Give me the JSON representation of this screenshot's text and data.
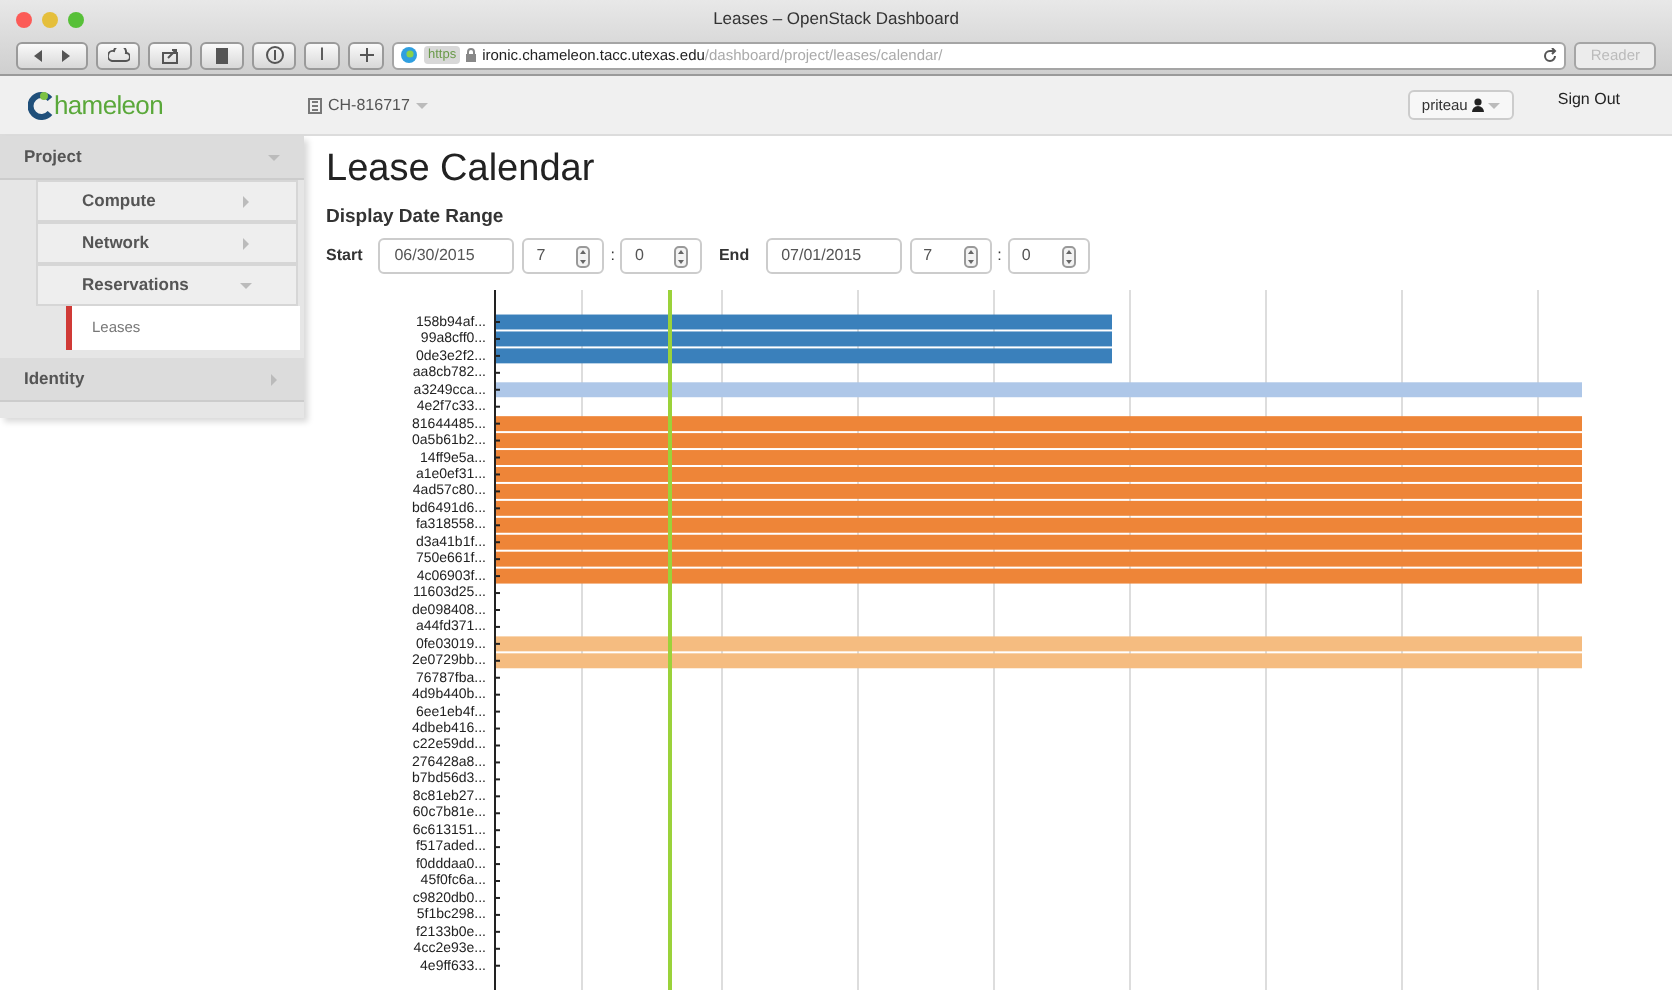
{
  "browser": {
    "title": "Leases – OpenStack Dashboard",
    "scheme": "https",
    "host": "ironic.chameleon.tacc.utexas.edu",
    "path": "/dashboard/project/leases/calendar/",
    "toolbar_glyph": "I",
    "reader": {
      "label": "Reader",
      "disabled": true
    }
  },
  "topbar": {
    "logo": "hameleon",
    "project": "CH-816717",
    "user": "priteau",
    "sign_out": "Sign Out"
  },
  "sidebar": [
    {
      "label": "Project",
      "expanded": true,
      "children": [
        {
          "label": "Compute",
          "expanded": false
        },
        {
          "label": "Network",
          "expanded": false
        },
        {
          "label": "Reservations",
          "expanded": true,
          "children": [
            {
              "label": "Leases",
              "selected": true
            }
          ]
        }
      ]
    },
    {
      "label": "Identity",
      "expanded": false
    }
  ],
  "page": {
    "title": "Lease Calendar",
    "subtitle": "Display Date Range",
    "start": {
      "label": "Start",
      "date": "06/30/2015",
      "hour": "7",
      "minute": "0"
    },
    "separator": ":",
    "end": {
      "label": "End",
      "date": "07/01/2015",
      "hour": "7",
      "minute": "0"
    }
  },
  "leases": [
    {
      "label": "158b94af...",
      "kind": "short",
      "color": "#3a80bb"
    },
    {
      "label": "99a8cff0...",
      "kind": "short",
      "color": "#3a80bb"
    },
    {
      "label": "0de3e2f2...",
      "kind": "short",
      "color": "#3a80bb"
    },
    {
      "label": "aa8cb782...",
      "kind": "none"
    },
    {
      "label": "a3249cca...",
      "kind": "full",
      "color": "#aec7e8"
    },
    {
      "label": "4e2f7c33...",
      "kind": "none"
    },
    {
      "label": "81644485...",
      "kind": "full",
      "color": "#ee8538"
    },
    {
      "label": "0a5b61b2...",
      "kind": "full",
      "color": "#ee8538"
    },
    {
      "label": "14ff9e5a...",
      "kind": "full",
      "color": "#ee8538"
    },
    {
      "label": "a1e0ef31...",
      "kind": "full",
      "color": "#ee8538"
    },
    {
      "label": "4ad57c80...",
      "kind": "full",
      "color": "#ee8538"
    },
    {
      "label": "bd6491d6...",
      "kind": "full",
      "color": "#ee8538"
    },
    {
      "label": "fa318558...",
      "kind": "full",
      "color": "#ee8538"
    },
    {
      "label": "d3a41b1f...",
      "kind": "full",
      "color": "#ee8538"
    },
    {
      "label": "750e661f...",
      "kind": "full",
      "color": "#ee8538"
    },
    {
      "label": "4c06903f...",
      "kind": "full",
      "color": "#ee8538"
    },
    {
      "label": "11603d25...",
      "kind": "none"
    },
    {
      "label": "de098408...",
      "kind": "none"
    },
    {
      "label": "a44fd371...",
      "kind": "none"
    },
    {
      "label": "0fe03019...",
      "kind": "full",
      "color": "#f5bc80"
    },
    {
      "label": "2e0729bb...",
      "kind": "full",
      "color": "#f5bc80"
    },
    {
      "label": "76787fba...",
      "kind": "none"
    },
    {
      "label": "4d9b440b...",
      "kind": "none"
    },
    {
      "label": "6ee1eb4f...",
      "kind": "none"
    },
    {
      "label": "4dbeb416...",
      "kind": "none"
    },
    {
      "label": "c22e59dd...",
      "kind": "none"
    },
    {
      "label": "276428a8...",
      "kind": "none"
    },
    {
      "label": "b7bd56d3...",
      "kind": "none"
    },
    {
      "label": "8c81eb27...",
      "kind": "none"
    },
    {
      "label": "60c7b81e...",
      "kind": "none"
    },
    {
      "label": "6c613151...",
      "kind": "none"
    },
    {
      "label": "f517aded...",
      "kind": "none"
    },
    {
      "label": "f0dddaa0...",
      "kind": "none"
    },
    {
      "label": "45f0fc6a...",
      "kind": "none"
    },
    {
      "label": "c9820db0...",
      "kind": "none"
    },
    {
      "label": "5f1bc298...",
      "kind": "none"
    },
    {
      "label": "f2133b0e...",
      "kind": "none"
    },
    {
      "label": "4cc2e93e...",
      "kind": "none"
    },
    {
      "label": "4e9ff633...",
      "kind": "none"
    }
  ]
}
